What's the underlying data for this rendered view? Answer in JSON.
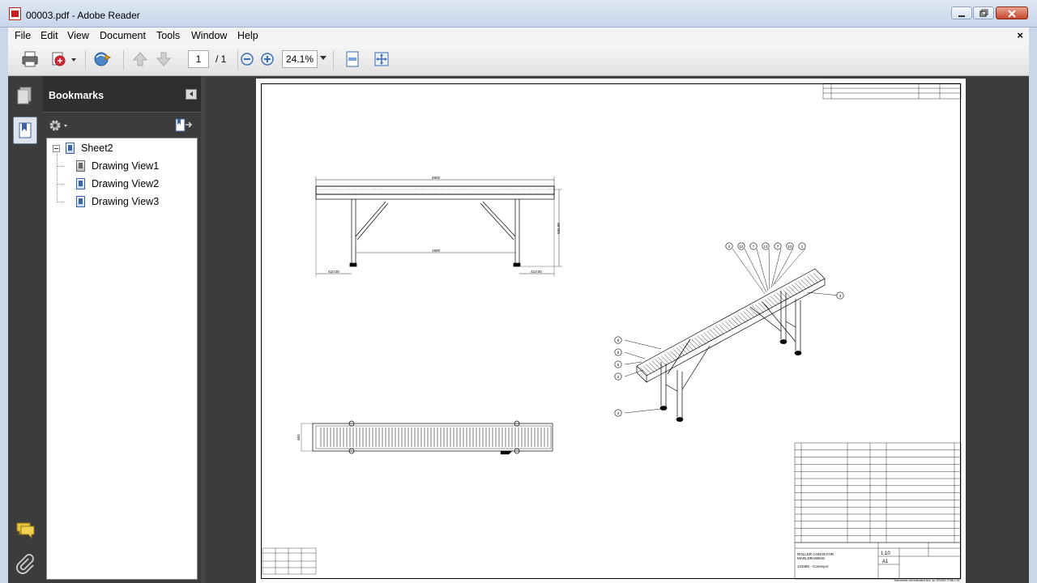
{
  "window": {
    "title": "00003.pdf - Adobe Reader",
    "minimize_icon": "minimize-icon",
    "maximize_icon": "maximize-icon",
    "close_icon": "close-icon"
  },
  "menu": {
    "items": [
      "File",
      "Edit",
      "View",
      "Document",
      "Tools",
      "Window",
      "Help"
    ],
    "close_doc": "×"
  },
  "toolbar": {
    "page_current": "1",
    "page_total": "/ 1",
    "zoom": "24.1%"
  },
  "bookmarks": {
    "title": "Bookmarks",
    "root": "Sheet2",
    "items": [
      "Drawing View1",
      "Drawing View2",
      "Drawing View3"
    ]
  },
  "drawing": {
    "dims": {
      "overall_length": "2800",
      "inner_span": "1900",
      "height": "550.00",
      "left_offset": "410.00",
      "right_offset": "410.00",
      "plan_width": "604"
    },
    "balloons": [
      "4",
      "12",
      "7",
      "12",
      "7",
      "10",
      "1",
      "3",
      "8",
      "5",
      "6",
      "2",
      "4"
    ],
    "title_block": {
      "name_line1": "ROLLER CONVEYOR",
      "name_line2": "MAIN DRAWING",
      "part": "123460 - Conveyor",
      "scale": "1:10",
      "sheet_size": "A1",
      "tolerance_note": "Tolerances not indicated Acc. to: DS/ISO 2768-1 M"
    }
  },
  "colors": {
    "app_bg": "#3c3c3c",
    "frame": "#c9d7e9",
    "page": "#ffffff"
  }
}
